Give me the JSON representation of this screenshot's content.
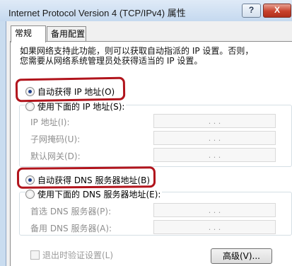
{
  "window": {
    "title": "Internet Protocol Version 4 (TCP/IPv4) 属性",
    "help_label": "?",
    "close_label": "X"
  },
  "tabs": [
    {
      "label": "常规",
      "active": true
    },
    {
      "label": "备用配置",
      "active": false
    }
  ],
  "description": [
    "如果网络支持此功能，则可以获取自动指派的 IP 设置。否则，",
    "您需要从网络系统管理员处获得适当的 IP 设置。"
  ],
  "ip_section": {
    "auto_label": "自动获得 IP 地址(O)",
    "auto_selected": true,
    "manual_label": "使用下面的 IP 地址(S):",
    "manual_selected": false,
    "fields": [
      {
        "label": "IP 地址(I):",
        "value": ". . ."
      },
      {
        "label": "子网掩码(U):",
        "value": ". . ."
      },
      {
        "label": "默认网关(D):",
        "value": ". . ."
      }
    ]
  },
  "dns_section": {
    "auto_label": "自动获得 DNS 服务器地址(B)",
    "auto_selected": true,
    "manual_label": "使用下面的 DNS 服务器地址(E):",
    "manual_selected": false,
    "fields": [
      {
        "label": "首选 DNS 服务器(P):",
        "value": ". . ."
      },
      {
        "label": "备用 DNS 服务器(A):",
        "value": ". . ."
      }
    ]
  },
  "validate_on_exit_label": "退出时验证设置(L)",
  "validate_on_exit_checked": false,
  "advanced_button_label": "高级(V)...",
  "colors": {
    "highlight": "#b1141c",
    "close_button": "#c8412c",
    "radio_dot": "#1f3f8a"
  }
}
